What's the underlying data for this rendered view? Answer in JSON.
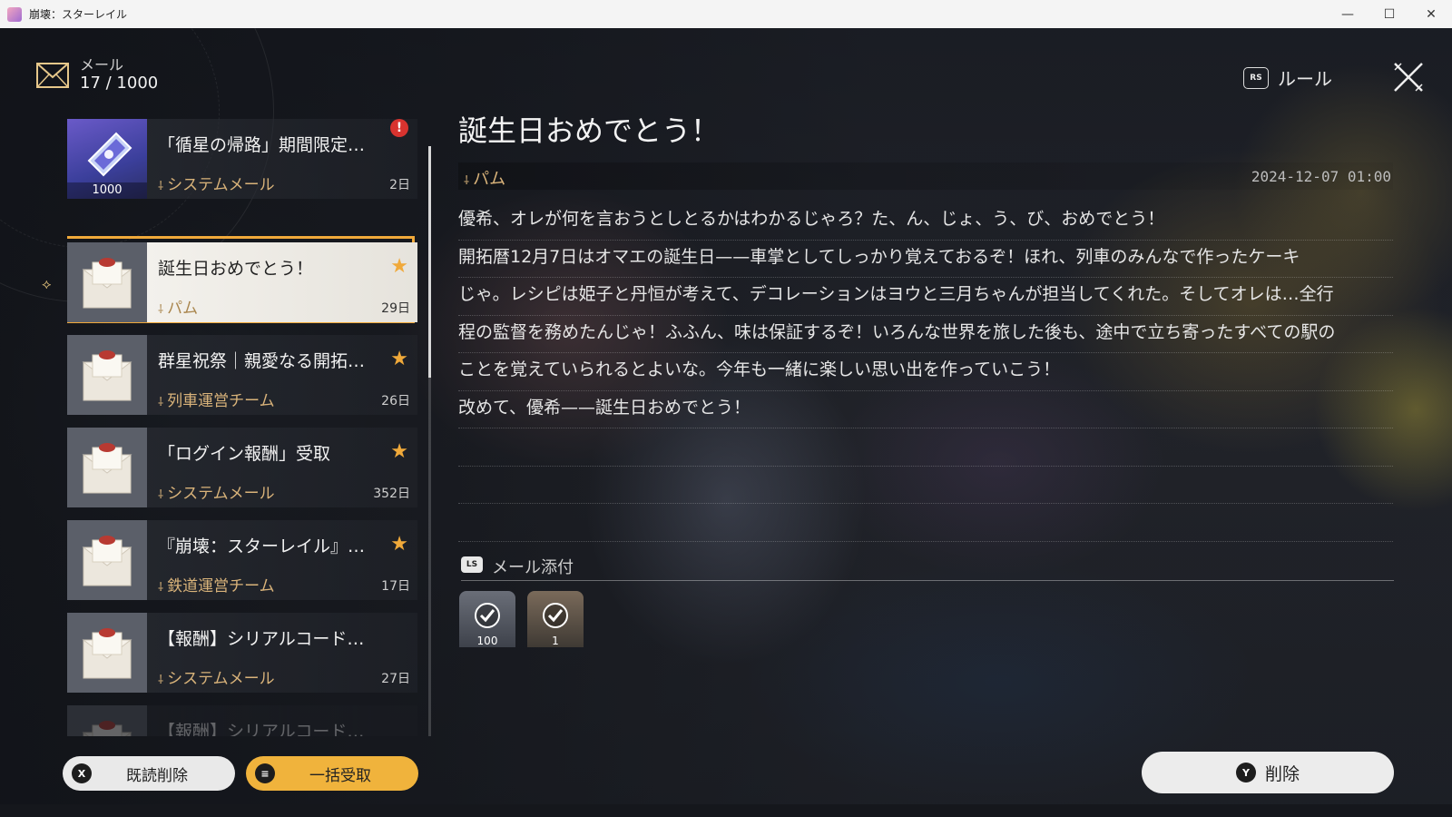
{
  "window": {
    "title": "崩壊：スターレイル",
    "minimize": "—",
    "maximize": "☐",
    "close": "✕"
  },
  "header": {
    "label": "メール",
    "count": "17 / 1000",
    "rules_badge": "RS",
    "rules_label": "ルール"
  },
  "mail_list": [
    {
      "subject": "「循星の帰路」期間限定…",
      "sender": "システムメール",
      "days": "2日",
      "thumb": "ticket",
      "quantity": "1000",
      "flag": "alert",
      "alert_mark": "!"
    },
    {
      "subject": "誕生日おめでとう！",
      "sender": "パム",
      "days": "29日",
      "thumb": "envelope",
      "flag": "star",
      "selected": true
    },
    {
      "subject": "群星祝祭｜親愛なる開拓…",
      "sender": "列車運営チーム",
      "days": "26日",
      "thumb": "envelope",
      "flag": "star"
    },
    {
      "subject": "「ログイン報酬」受取",
      "sender": "システムメール",
      "days": "352日",
      "thumb": "envelope",
      "flag": "star"
    },
    {
      "subject": "『崩壊：スターレイル』…",
      "sender": "鉄道運営チーム",
      "days": "17日",
      "thumb": "envelope",
      "flag": "star"
    },
    {
      "subject": "【報酬】シリアルコード…",
      "sender": "システムメール",
      "days": "27日",
      "thumb": "envelope",
      "flag": "none"
    },
    {
      "subject": "【報酬】シリアルコード…",
      "sender": "",
      "days": "",
      "thumb": "envelope",
      "flag": "none"
    }
  ],
  "detail": {
    "title": "誕生日おめでとう！",
    "from": "パム",
    "date": "2024-12-07 01:00",
    "body_lines": [
      "優希、オレが何を言おうとしとるかはわかるじゃろ？た、ん、じょ、う、び、おめでとう！",
      "開拓暦12月7日はオマエの誕生日——車掌としてしっかり覚えておるぞ！ほれ、列車のみんなで作ったケーキ",
      "じゃ。レシピは姫子と丹恒が考えて、デコレーションはヨウと三月ちゃんが担当してくれた。そしてオレは…全行",
      "程の監督を務めたんじゃ！ふふん、味は保証するぞ！いろんな世界を旅した後も、途中で立ち寄ったすべての駅の",
      "ことを覚えていられるとよいな。今年も一緒に楽しい思い出を作っていこう！",
      "改めて、優希——誕生日おめでとう！",
      "",
      "",
      ""
    ]
  },
  "attachments": {
    "key": "LS",
    "label": "メール添付",
    "items": [
      {
        "name": "credits",
        "quantity": "100",
        "claimed": true
      },
      {
        "name": "cake-item",
        "quantity": "1",
        "claimed": true
      }
    ]
  },
  "buttons": {
    "delete_read": {
      "key": "X",
      "label": "既読削除"
    },
    "claim_all": {
      "key": "≡",
      "label": "一括受取"
    },
    "delete": {
      "key": "Y",
      "label": "削除"
    }
  },
  "colors": {
    "accent": "#f0a93a",
    "sender": "#d9b37a",
    "alert": "#d8332f",
    "claim_button": "#f0b33c"
  }
}
